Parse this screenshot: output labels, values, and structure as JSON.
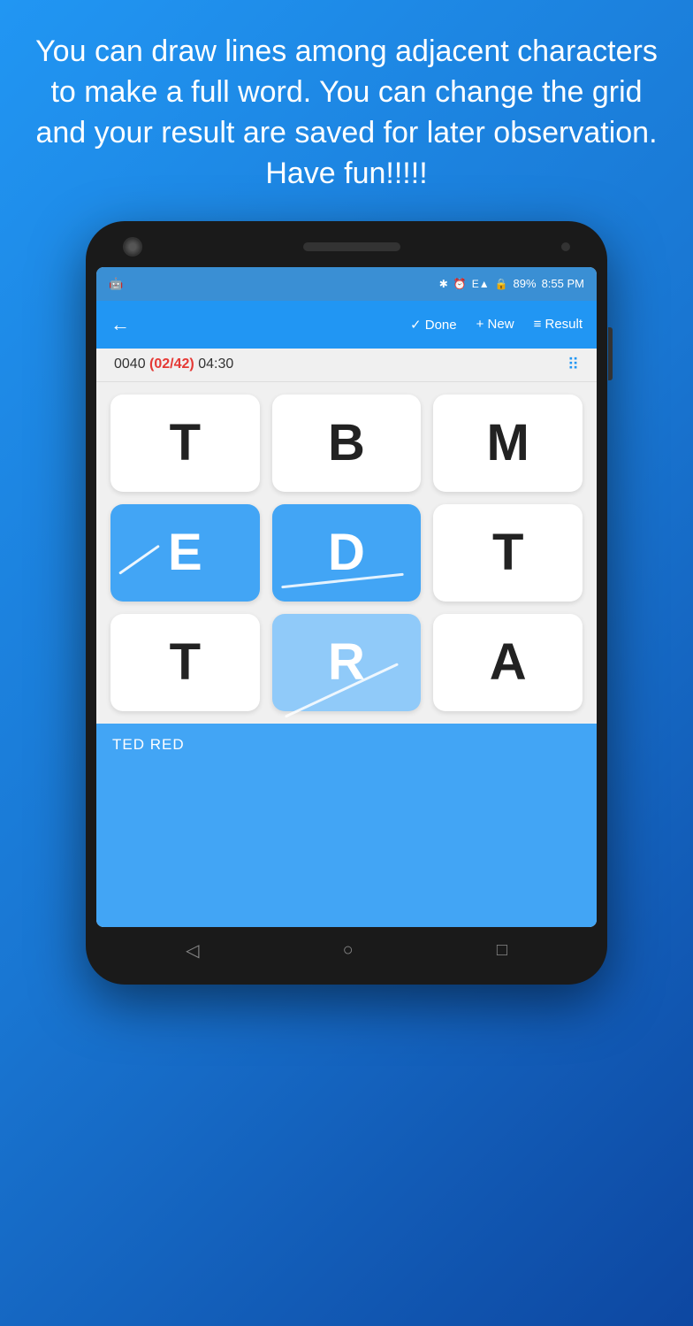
{
  "headline": "You can draw lines among adjacent characters to make a full word. You can change the grid and your result are saved for later observation. Have fun!!!!!",
  "status_bar": {
    "battery": "89%",
    "time": "8:55 PM",
    "icons": [
      "bluetooth",
      "alarm",
      "signal",
      "lock",
      "battery"
    ]
  },
  "app_bar": {
    "back_label": "←",
    "done_label": "✓ Done",
    "new_label": "+ New",
    "result_label": "≡ Result"
  },
  "timer": {
    "code": "0040",
    "fraction": "(02/42)",
    "time": "04:30"
  },
  "grid": [
    {
      "letter": "T",
      "state": "normal",
      "row": 0,
      "col": 0
    },
    {
      "letter": "B",
      "state": "normal",
      "row": 0,
      "col": 1
    },
    {
      "letter": "M",
      "state": "normal",
      "row": 0,
      "col": 2
    },
    {
      "letter": "E",
      "state": "active-blue",
      "row": 1,
      "col": 0
    },
    {
      "letter": "D",
      "state": "active-blue",
      "row": 1,
      "col": 1
    },
    {
      "letter": "T",
      "state": "normal",
      "row": 1,
      "col": 2
    },
    {
      "letter": "T",
      "state": "normal",
      "row": 2,
      "col": 0
    },
    {
      "letter": "R",
      "state": "active-light",
      "row": 2,
      "col": 1
    },
    {
      "letter": "A",
      "state": "normal",
      "row": 2,
      "col": 2
    }
  ],
  "found_words": "TED  RED",
  "nav": {
    "back": "◁",
    "home": "○",
    "recent": "□"
  }
}
